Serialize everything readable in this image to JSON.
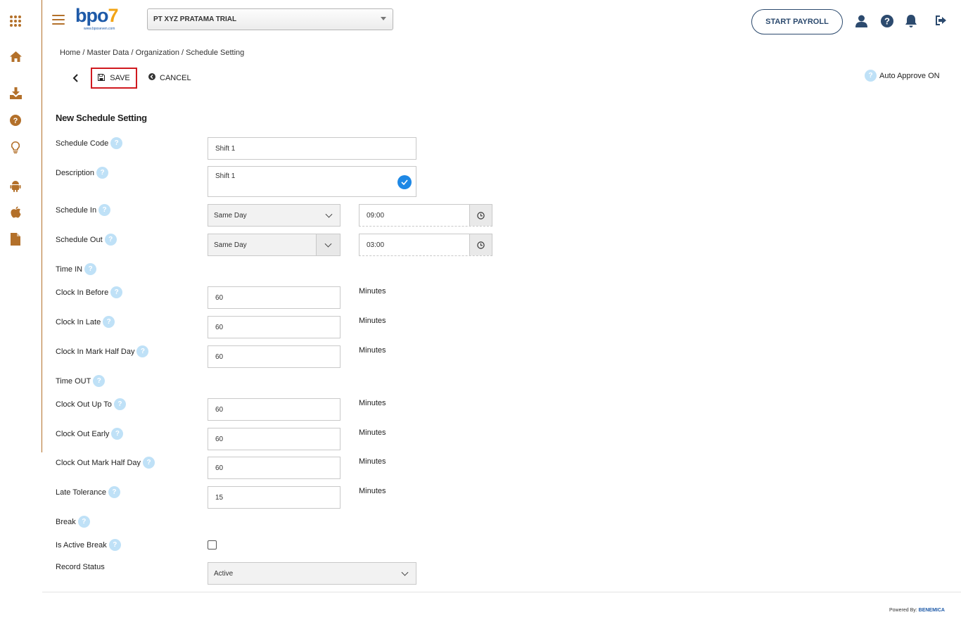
{
  "app": {
    "logo_text": "bpo",
    "logo_seven": "7",
    "logo_sub": "www.bposeven.com",
    "company": "PT XYZ PRATAMA TRIAL",
    "start_payroll": "START PAYROLL"
  },
  "breadcrumb": "Home / Master Data / Organization / Schedule Setting",
  "toolbar": {
    "save": "SAVE",
    "cancel": "CANCEL",
    "auto_approve": "Auto Approve ON"
  },
  "form": {
    "title": "New Schedule Setting",
    "schedule_code": {
      "label": "Schedule Code",
      "value": "Shift 1"
    },
    "description": {
      "label": "Description",
      "value": "Shift 1"
    },
    "schedule_in": {
      "label": "Schedule In",
      "day": "Same Day",
      "time": "09:00"
    },
    "schedule_out": {
      "label": "Schedule Out",
      "day": "Same Day",
      "time": "03:00"
    },
    "time_in": {
      "label": "Time IN"
    },
    "clock_in_before": {
      "label": "Clock In Before",
      "value": "60",
      "unit": "Minutes"
    },
    "clock_in_late": {
      "label": "Clock In Late",
      "value": "60",
      "unit": "Minutes"
    },
    "clock_in_half": {
      "label": "Clock In Mark Half Day",
      "value": "60",
      "unit": "Minutes"
    },
    "time_out": {
      "label": "Time OUT"
    },
    "clock_out_upto": {
      "label": "Clock Out Up To",
      "value": "60",
      "unit": "Minutes"
    },
    "clock_out_early": {
      "label": "Clock Out Early",
      "value": "60",
      "unit": "Minutes"
    },
    "clock_out_half": {
      "label": "Clock Out Mark Half Day",
      "value": "60",
      "unit": "Minutes"
    },
    "late_tolerance": {
      "label": "Late Tolerance",
      "value": "15",
      "unit": "Minutes"
    },
    "break": {
      "label": "Break"
    },
    "is_active_break": {
      "label": "Is Active Break",
      "checked": false
    },
    "record_status": {
      "label": "Record Status",
      "value": "Active"
    }
  },
  "footer": {
    "powered_by": "Powered By:",
    "brand": "BENEMICA"
  },
  "help_glyph": "?",
  "colors": {
    "accent": "#b3702a",
    "navy": "#2c4a6e",
    "save_border": "#d0191f",
    "help": "#bfe1f7"
  }
}
